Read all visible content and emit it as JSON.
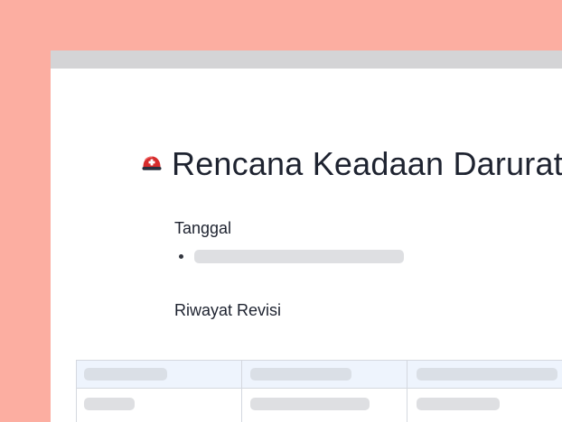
{
  "document": {
    "title": "Rencana Keadaan Darurat",
    "title_icon": "helmet-icon",
    "sections": {
      "tanggal": {
        "heading": "Tanggal"
      },
      "riwayat": {
        "heading": "Riwayat Revisi"
      }
    }
  },
  "colors": {
    "background": "#fcaea1",
    "topbar": "#d4d4d6",
    "helmet_red": "#d62c2c",
    "placeholder": "#dedfe2",
    "table_header": "#eef4fd"
  }
}
